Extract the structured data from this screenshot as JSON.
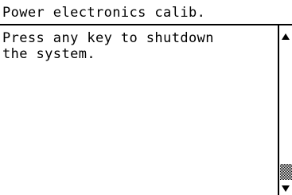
{
  "header": {
    "title": "Power electronics calib."
  },
  "content": {
    "message": "Press any key to shutdown\nthe system."
  },
  "scrollbar": {
    "up_icon": "triangle-up",
    "down_icon": "triangle-down",
    "position_fraction": 0.95
  }
}
